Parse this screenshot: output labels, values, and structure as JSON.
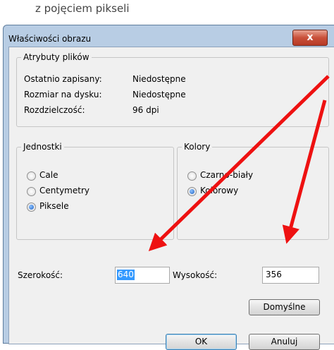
{
  "caption": "z pojęciem pikseli",
  "window": {
    "title": "Właściwości obrazu",
    "close_glyph": "x"
  },
  "file_attributes": {
    "legend": "Atrybuty plików",
    "rows": [
      {
        "label": "Ostatnio zapisany:",
        "value": "Niedostępne"
      },
      {
        "label": "Rozmiar na dysku:",
        "value": "Niedostępne"
      },
      {
        "label": "Rozdzielczość:",
        "value": "96 dpi"
      }
    ]
  },
  "units": {
    "legend": "Jednostki",
    "options": [
      "Cale",
      "Centymetry",
      "Piksele"
    ],
    "selected": "Piksele"
  },
  "colors": {
    "legend": "Kolory",
    "options": [
      "Czarno-biały",
      "Kolorowy"
    ],
    "selected": "Kolorowy"
  },
  "dimensions": {
    "width_label": "Szerokość:",
    "width_value": "640",
    "height_label": "Wysokość:",
    "height_value": "356"
  },
  "buttons": {
    "default": "Domyślne",
    "ok": "OK",
    "cancel": "Anuluj"
  },
  "annotation": {
    "arrow_color": "#ee1111"
  }
}
